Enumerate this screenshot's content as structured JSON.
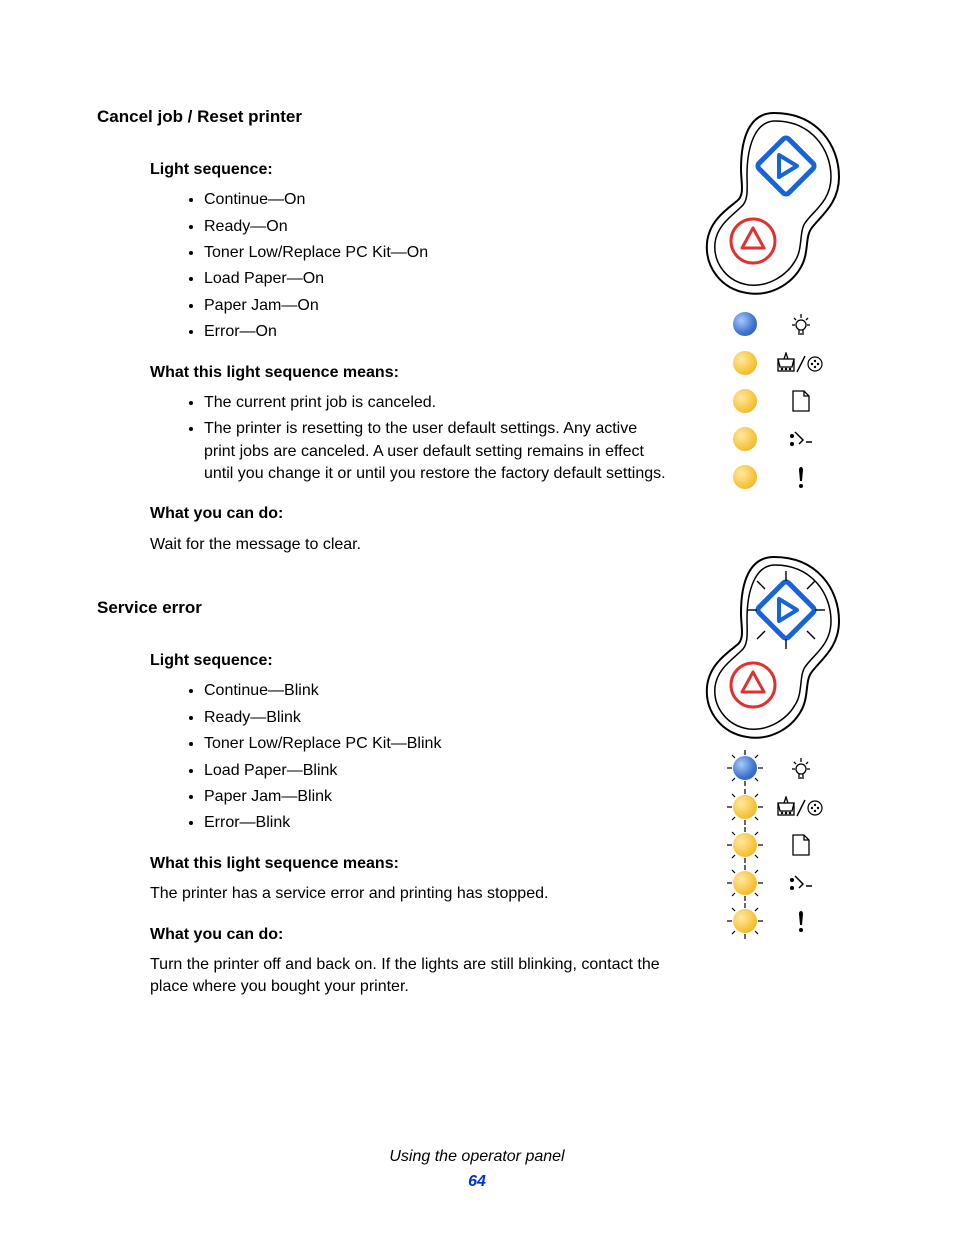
{
  "sections": [
    {
      "title": "Cancel job / Reset printer",
      "light_sequence_heading": "Light sequence:",
      "light_sequence": [
        "Continue—On",
        "Ready—On",
        "Toner Low/Replace PC Kit—On",
        "Load Paper—On",
        "Paper Jam—On",
        "Error—On"
      ],
      "means_heading": "What this light sequence means:",
      "means_bullets": [
        "The current print job is canceled.",
        "The printer is resetting to the user default settings. Any active print jobs are canceled. A user default setting remains in effect until you change it or until you restore the factory default settings."
      ],
      "do_heading": "What you can do:",
      "do_text": "Wait for the message to clear.",
      "blink": false
    },
    {
      "title": "Service error",
      "light_sequence_heading": "Light sequence:",
      "light_sequence": [
        "Continue—Blink",
        "Ready—Blink",
        "Toner Low/Replace PC Kit—Blink",
        "Load Paper—Blink",
        "Paper Jam—Blink",
        "Error—Blink"
      ],
      "means_heading": "What this light sequence means:",
      "means_text": "The printer has a service error and printing has stopped.",
      "do_heading": "What you can do:",
      "do_text": "Turn the printer off and back on. If the lights are still blinking, contact the place where you bought your printer.",
      "blink": true
    }
  ],
  "footer_text": "Using the operator panel",
  "page_number": "64",
  "icon_names": [
    "ready-bulb-icon",
    "toner-box-icon",
    "load-paper-icon",
    "paper-jam-icon",
    "error-exclaim-icon"
  ]
}
